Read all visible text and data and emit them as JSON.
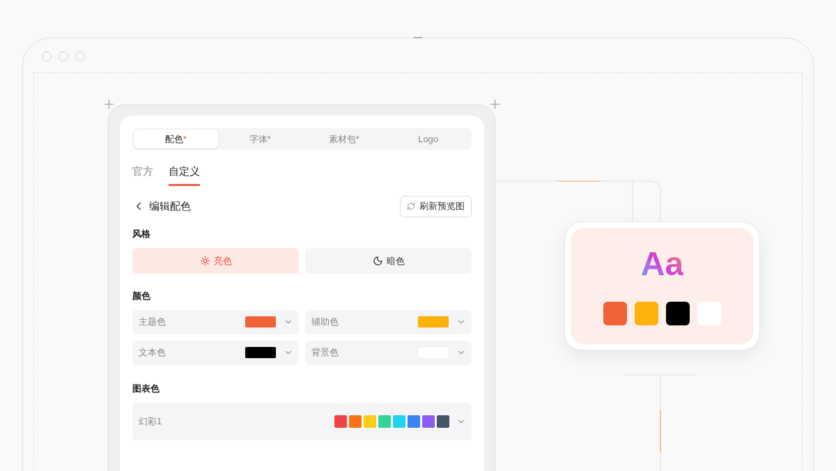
{
  "tabs": [
    {
      "label": "配色",
      "mark": "*",
      "selected": true
    },
    {
      "label": "字体",
      "mark": "*",
      "selected": false
    },
    {
      "label": "素材包",
      "mark": "*",
      "selected": false
    },
    {
      "label": "Logo",
      "selected": false
    }
  ],
  "subtabs": [
    {
      "label": "官方",
      "selected": false
    },
    {
      "label": "自定义",
      "selected": true
    }
  ],
  "header": {
    "title": "编辑配色",
    "refresh_button": "刷新预览图"
  },
  "style_section": {
    "title": "风格",
    "options": [
      {
        "label": "亮色",
        "kind": "light",
        "selected": true
      },
      {
        "label": "暗色",
        "kind": "dark",
        "selected": false
      }
    ]
  },
  "colors_section": {
    "title": "颜色",
    "items": [
      {
        "label": "主题色",
        "color": "#f06339"
      },
      {
        "label": "辅助色",
        "color": "#fdb10a"
      },
      {
        "label": "文本色",
        "color": "#000000"
      },
      {
        "label": "背景色",
        "color": "#ffffff"
      }
    ]
  },
  "chart_section": {
    "title": "图表色",
    "palette": {
      "label": "幻彩1",
      "colors": [
        {
          "color": "#ef4444"
        },
        {
          "color": "#f97316"
        },
        {
          "color": "#facc15"
        },
        {
          "color": "#34d399"
        },
        {
          "color": "#22d3ee"
        },
        {
          "color": "#3b82f6"
        },
        {
          "color": "#8b5cf6"
        },
        {
          "color": "#475569"
        }
      ]
    }
  },
  "preview": {
    "sample": "Aa",
    "swatches": [
      {
        "color": "#f06339"
      },
      {
        "color": "#fdb10a"
      },
      {
        "color": "#000000"
      },
      {
        "color": "#ffffff"
      }
    ]
  }
}
